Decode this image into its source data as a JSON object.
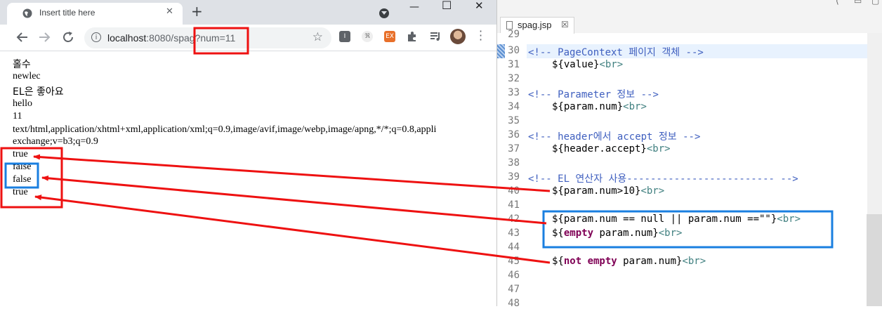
{
  "browser": {
    "tab_title": "Insert title here",
    "tab_close": "✕",
    "new_tab": "+",
    "url_host": "localhost",
    "url_port": ":8080/",
    "url_path": "spag",
    "url_query": "?num=11",
    "window_controls": {
      "minimize": "—",
      "maximize": "☐",
      "close": "✕"
    },
    "content_lines": [
      "홀수",
      "newlec",
      "EL은 좋아요",
      "hello",
      "11",
      "text/html,application/xhtml+xml,application/xml;q=0.9,image/avif,image/webp,image/apng,*/*;q=0.8,appli",
      "exchange;v=b3;q=0.9",
      "true",
      "false",
      "false",
      "true"
    ],
    "icons": [
      "globe-icon",
      "back-icon",
      "forward-icon",
      "reload-icon",
      "info-icon",
      "star-icon",
      "extension-icon",
      "menu-icon"
    ]
  },
  "editor": {
    "file_tab": "spag.jsp",
    "tab_close": "☒",
    "line_numbers": [
      "29",
      "30",
      "31",
      "32",
      "33",
      "34",
      "35",
      "36",
      "37",
      "38",
      "39",
      "40",
      "41",
      "42",
      "43",
      "44",
      "45",
      "46",
      "47",
      "48"
    ],
    "code": {
      "l30_comment": "<!-- PageContext 페이지 객체 -->",
      "l31_expr": "${value}",
      "l31_tag": "<br>",
      "l33_comment": "<!-- Parameter 정보 -->",
      "l34_expr": "${param.num}",
      "l34_tag": "<br>",
      "l36_comment": "<!-- header에서 accept 정보 -->",
      "l37_expr": "${header.accept}",
      "l37_tag": "<br>",
      "l39_comment": "<!-- EL 연산자 사용------------------------- -->",
      "l40_expr": "${param.num>10}",
      "l40_tag": "<br>",
      "l42_expr": "${param.num == null || param.num ==\"\"}",
      "l42_tag": "<br>",
      "l43_open": "${",
      "l43_kw": "empty",
      "l43_rest": " param.num}",
      "l43_tag": "<br>",
      "l45_open": "${",
      "l45_kw": "not empty",
      "l45_rest": " param.num}",
      "l45_tag": "<br>"
    }
  },
  "colors": {
    "annotation_red": "#ee1111",
    "annotation_blue": "#1a7fe0",
    "comment": "#3f5fbf",
    "tag": "#3f7f7f",
    "keyword": "#7f0055"
  }
}
